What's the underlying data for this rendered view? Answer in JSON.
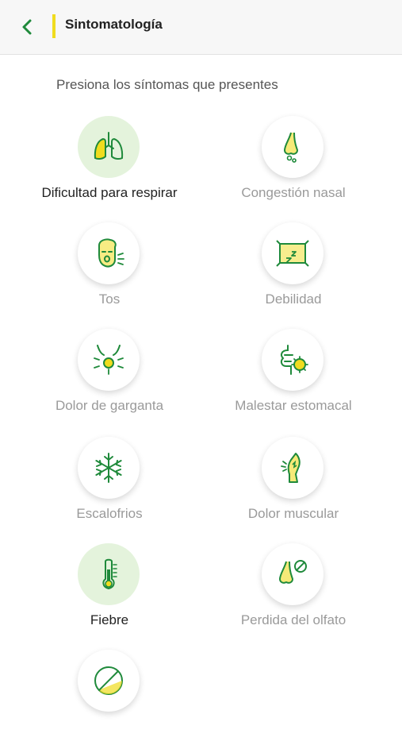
{
  "header": {
    "title": "Sintomatología"
  },
  "instruction": "Presiona los síntomas que presentes",
  "colors": {
    "accent_green": "#1f8a3b",
    "accent_yellow": "#f0dc1e",
    "selected_bg": "#e4f3dc"
  },
  "symptoms": [
    {
      "label": "Dificultad para respirar",
      "icon": "lungs-icon",
      "selected": true
    },
    {
      "label": "Congestión nasal",
      "icon": "runny-nose-icon",
      "selected": false
    },
    {
      "label": "Tos",
      "icon": "coughing-face-icon",
      "selected": false
    },
    {
      "label": "Debilidad",
      "icon": "sleep-pillow-icon",
      "selected": false
    },
    {
      "label": "Dolor de garganta",
      "icon": "sore-throat-icon",
      "selected": false
    },
    {
      "label": "Malestar estomacal",
      "icon": "stomach-virus-icon",
      "selected": false
    },
    {
      "label": "Escalofrios",
      "icon": "snowflake-icon",
      "selected": false
    },
    {
      "label": "Dolor muscular",
      "icon": "muscle-pain-icon",
      "selected": false
    },
    {
      "label": "Fiebre",
      "icon": "thermometer-icon",
      "selected": true
    },
    {
      "label": "Perdida del olfato",
      "icon": "no-smell-icon",
      "selected": false
    },
    {
      "label": "",
      "icon": "none-icon",
      "selected": false
    }
  ]
}
